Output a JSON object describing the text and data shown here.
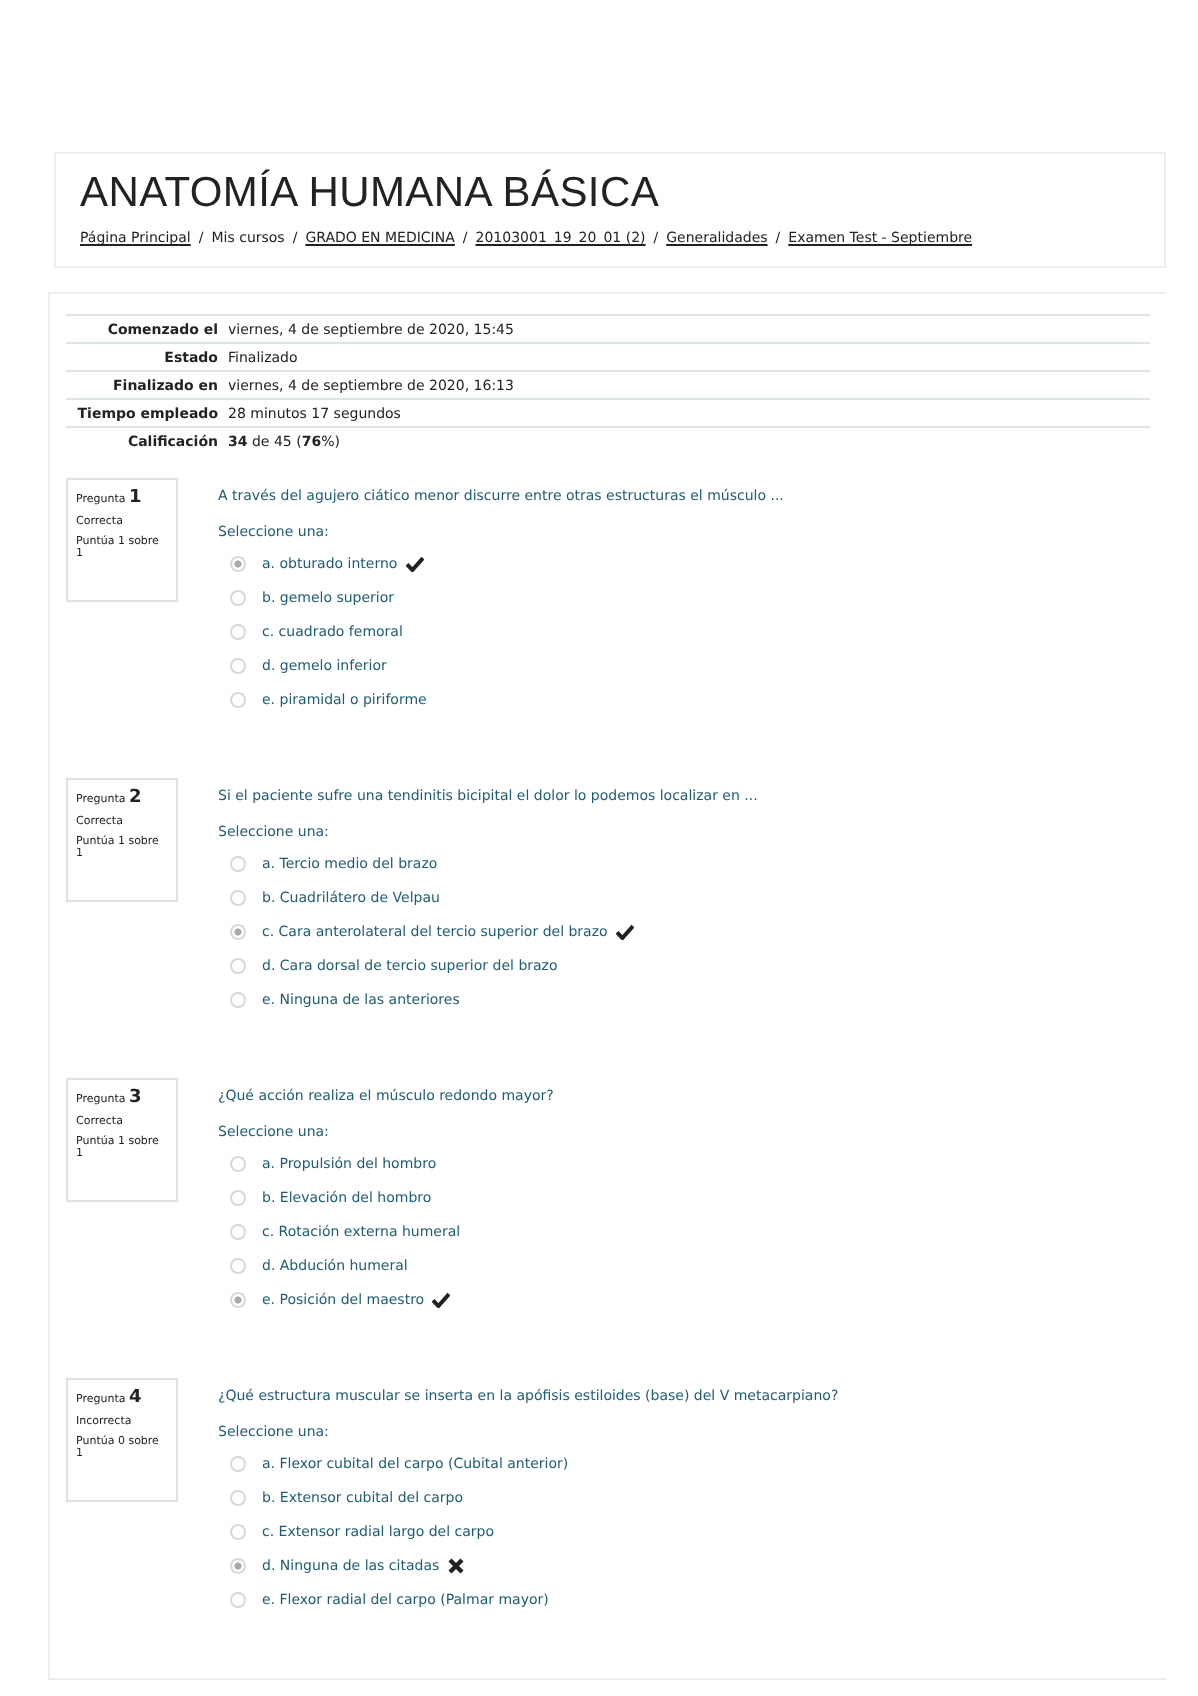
{
  "header": {
    "title": "ANATOMÍA HUMANA BÁSICA",
    "breadcrumb": [
      {
        "label": "Página Principal",
        "link": true
      },
      {
        "separator": "/",
        "label": "Mis cursos",
        "link": false
      },
      {
        "separator": "/",
        "label": "GRADO EN MEDICINA",
        "link": true
      },
      {
        "separator": "/",
        "label": "20103001_19_20_01 (2)",
        "link": true
      },
      {
        "separator": "/",
        "label": "Generalidades",
        "link": true
      },
      {
        "separator": "/",
        "label": "Examen Test - Septiembre",
        "link": true
      }
    ]
  },
  "summary": [
    {
      "label": "Comenzado el",
      "value": "viernes, 4 de septiembre de 2020, 15:45"
    },
    {
      "label": "Estado",
      "value": "Finalizado"
    },
    {
      "label": "Finalizado en",
      "value": "viernes, 4 de septiembre de 2020, 16:13"
    },
    {
      "label": "Tiempo empleado",
      "value": "28 minutos 17 segundos"
    },
    {
      "label": "Calificación",
      "value": "**34** de 45 (**76**%)"
    }
  ],
  "questions": [
    {
      "label": "Pregunta",
      "number": "1",
      "state": "Correcta",
      "grade": "Puntúa 1 sobre 1",
      "text": "A través del agujero ciático menor discurre entre otras estructuras el músculo ...",
      "prompt": "Seleccione una:",
      "options": [
        {
          "kind": "correct",
          "text": "a. obturado interno",
          "selected": true
        },
        {
          "kind": "plain",
          "text": "b. gemelo superior",
          "selected": false
        },
        {
          "kind": "plain",
          "text": "c. cuadrado femoral",
          "selected": false
        },
        {
          "kind": "plain",
          "text": "d. gemelo inferior",
          "selected": false
        },
        {
          "kind": "plain",
          "text": "e. piramidal o piriforme",
          "selected": false
        }
      ]
    },
    {
      "label": "Pregunta",
      "number": "2",
      "state": "Correcta",
      "grade": "Puntúa 1 sobre 1",
      "text": "Si el paciente sufre una tendinitis bicipital el dolor lo podemos localizar en ...",
      "prompt": "Seleccione una:",
      "options": [
        {
          "kind": "plain",
          "text": "a. Tercio medio del brazo",
          "selected": false
        },
        {
          "kind": "plain",
          "text": "b. Cuadrilátero de Velpau",
          "selected": false
        },
        {
          "kind": "correct",
          "text": "c. Cara anterolateral del tercio superior del brazo",
          "selected": true
        },
        {
          "kind": "plain",
          "text": "d. Cara dorsal de tercio superior del brazo",
          "selected": false
        },
        {
          "kind": "plain",
          "text": "e. Ninguna de las anteriores",
          "selected": false
        }
      ]
    },
    {
      "label": "Pregunta",
      "number": "3",
      "state": "Correcta",
      "grade": "Puntúa 1 sobre 1",
      "text": "¿Qué acción realiza el músculo redondo mayor?",
      "prompt": "Seleccione una:",
      "options": [
        {
          "kind": "plain",
          "text": "a. Propulsión del hombro",
          "selected": false
        },
        {
          "kind": "plain",
          "text": "b. Elevación del hombro",
          "selected": false
        },
        {
          "kind": "plain",
          "text": "c. Rotación externa humeral",
          "selected": false
        },
        {
          "kind": "plain",
          "text": "d. Abdución humeral",
          "selected": false
        },
        {
          "kind": "correct",
          "text": "e. Posición del maestro",
          "selected": true
        }
      ]
    },
    {
      "label": "Pregunta",
      "number": "4",
      "state": "Incorrecta",
      "grade": "Puntúa 0 sobre 1",
      "text": "¿Qué estructura muscular se inserta en la apófisis estiloides (base) del V metacarpiano?",
      "prompt": "Seleccione una:",
      "options": [
        {
          "kind": "plain",
          "text": "a. Flexor cubital del carpo (Cubital anterior)",
          "selected": false
        },
        {
          "kind": "plain",
          "text": "b. Extensor cubital del carpo",
          "selected": false
        },
        {
          "kind": "plain",
          "text": "c. Extensor radial largo del carpo",
          "selected": false
        },
        {
          "kind": "incorrect",
          "text": "d. Ninguna de las citadas",
          "selected": true
        },
        {
          "kind": "plain",
          "text": "e. Flexor radial del carpo (Palmar mayor)",
          "selected": false
        }
      ]
    }
  ]
}
